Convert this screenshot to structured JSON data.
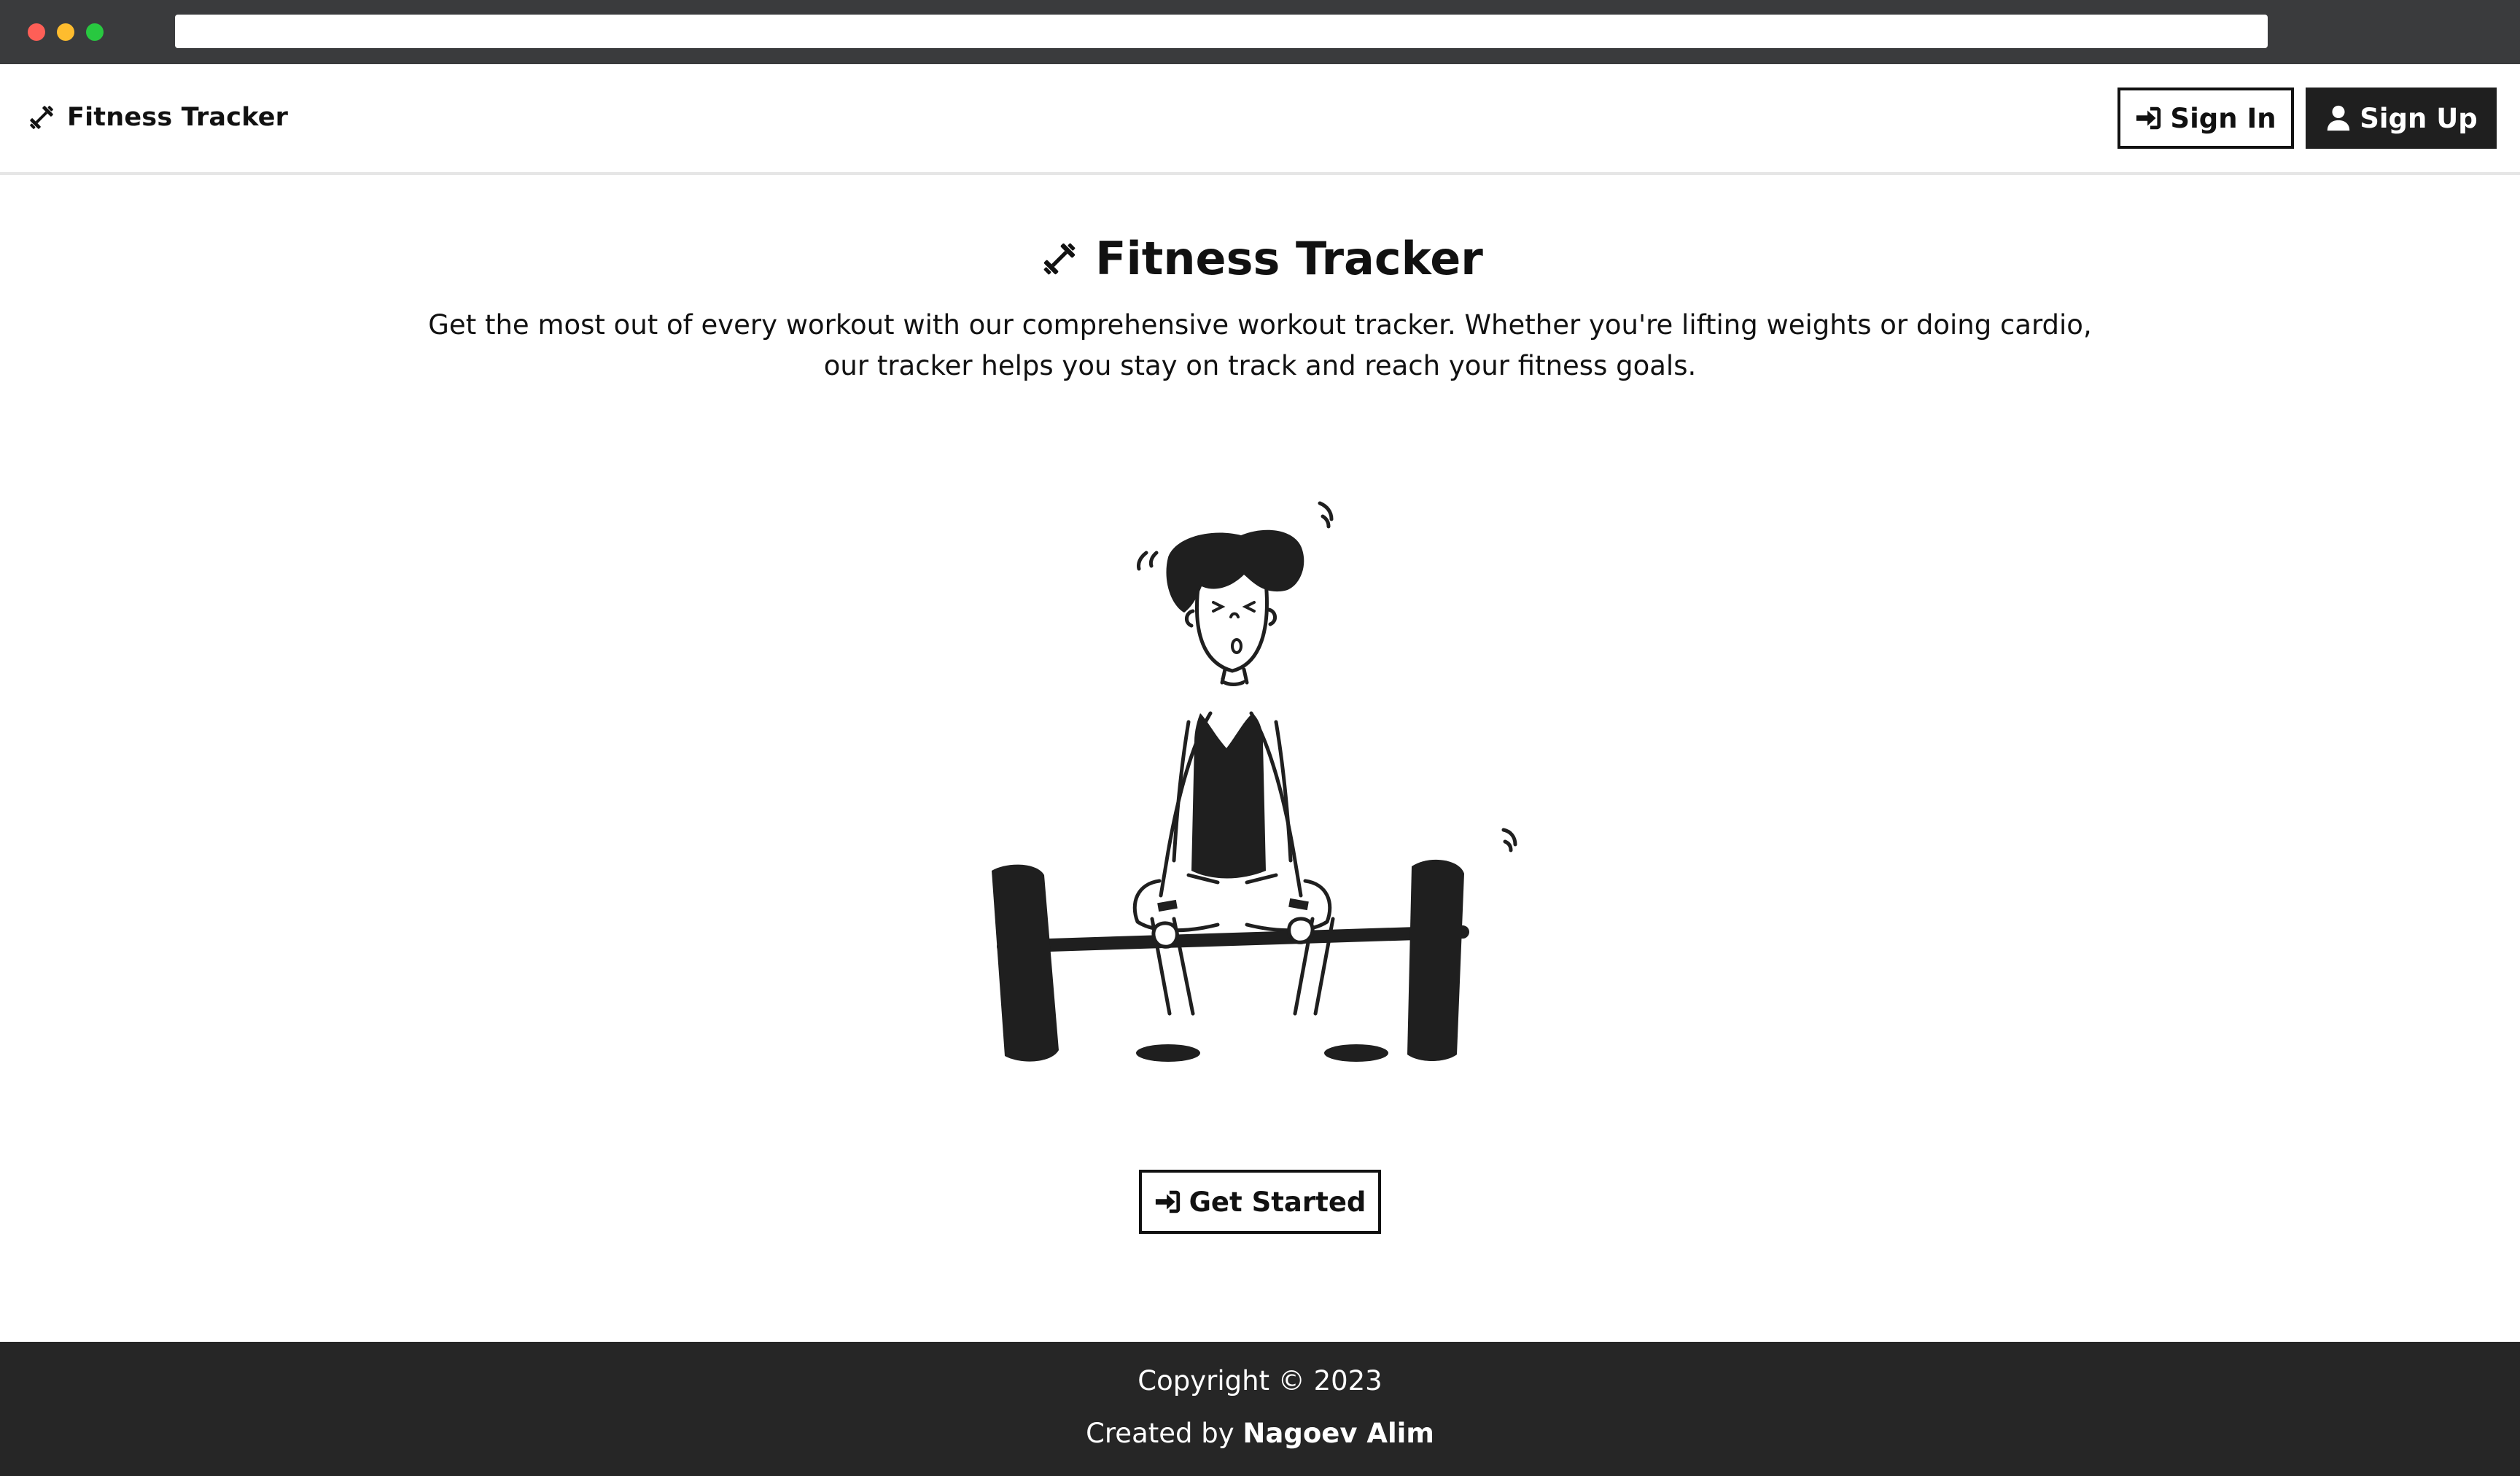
{
  "nav": {
    "brand": "Fitness Tracker",
    "sign_in_label": "Sign In",
    "sign_up_label": "Sign Up"
  },
  "hero": {
    "title": "Fitness Tracker",
    "description": "Get the most out of every workout with our comprehensive workout tracker. Whether you're lifting weights or doing cardio, our tracker helps you stay on track and reach your fitness goals.",
    "cta_label": "Get Started"
  },
  "footer": {
    "copyright": "Copyright © 2023",
    "created_by_prefix": "Created by ",
    "author": "Nagoev Alim"
  },
  "icons": {
    "brand": "dumbbell-icon",
    "sign_in": "sign-in-icon",
    "sign_up": "user-icon",
    "cta": "sign-in-icon"
  },
  "colors": {
    "chrome": "#3a3b3d",
    "primary_dark": "#1f1f1f",
    "footer_bg": "#262626",
    "text": "#111111"
  }
}
